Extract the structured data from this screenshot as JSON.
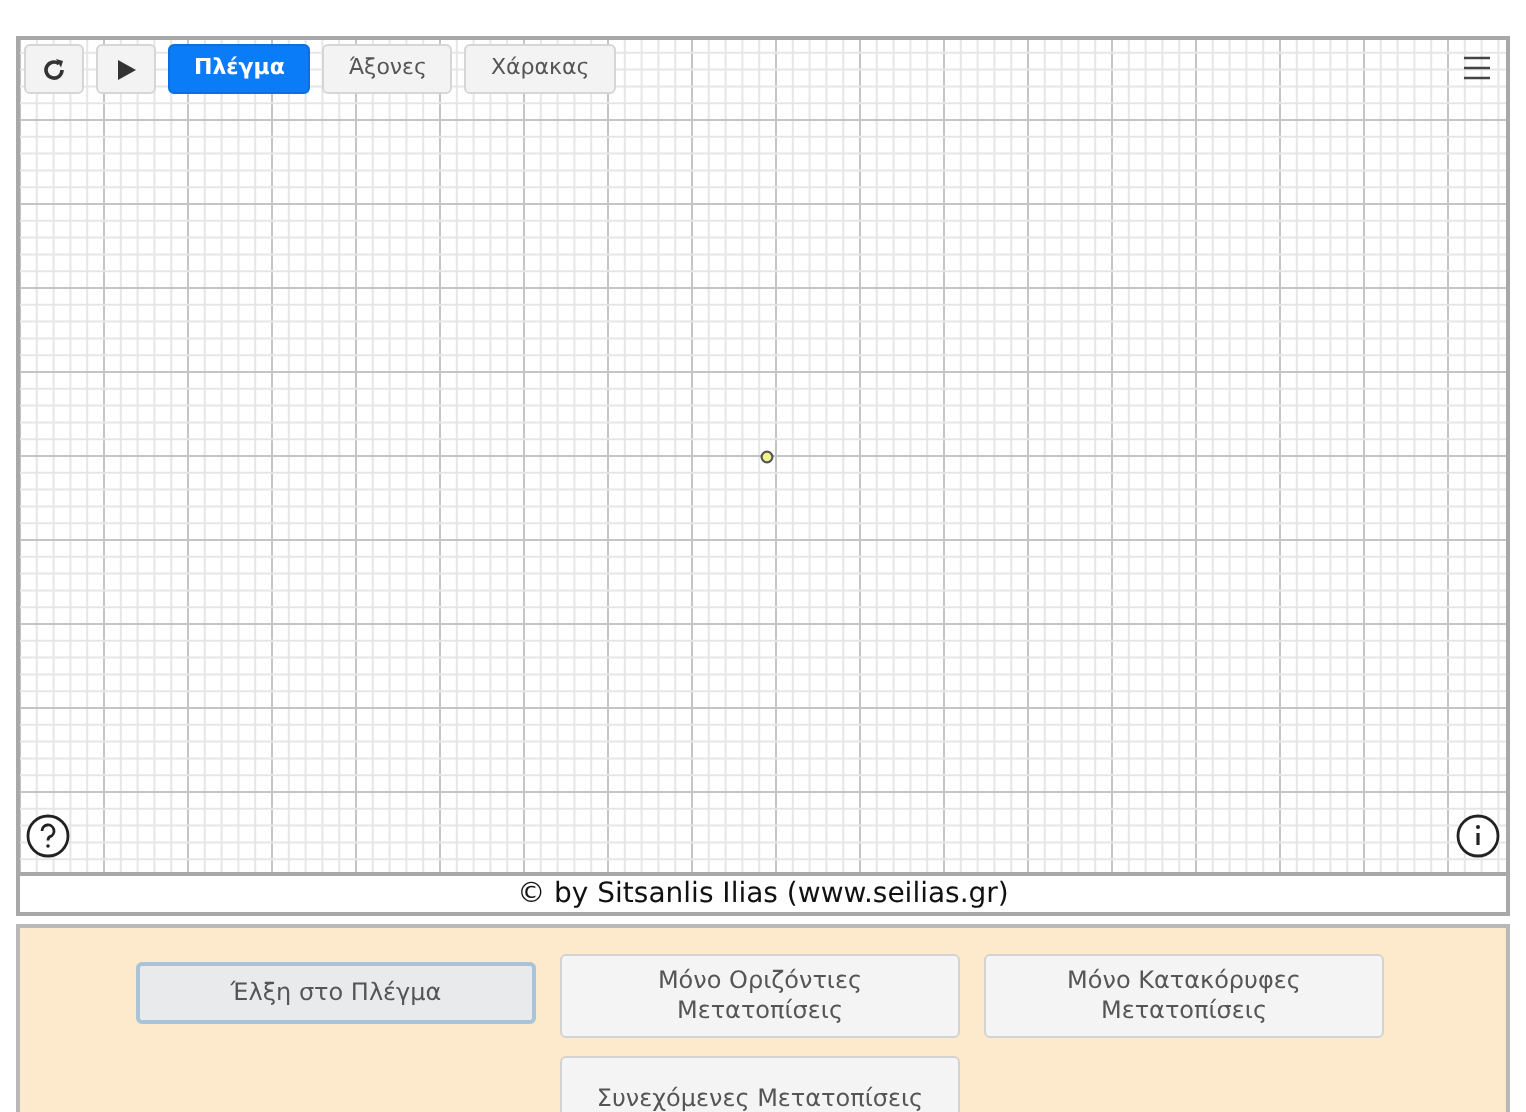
{
  "toolbar": {
    "buttons": [
      {
        "kind": "reset"
      },
      {
        "kind": "play"
      }
    ],
    "tabs": [
      {
        "label": "Πλέγμα",
        "selected": true
      },
      {
        "label": "Άξονες",
        "selected": false
      },
      {
        "label": "Χάρακας",
        "selected": false
      }
    ]
  },
  "footer": {
    "credit": "© by Sitsanlis Ilias (www.seilias.gr)"
  },
  "options": [
    {
      "label": "Έλξη στο Πλέγμα",
      "selected": true
    },
    {
      "label": "Μόνο Οριζόντιες Μετατοπίσεις",
      "selected": false
    },
    {
      "label": "Μόνο Κατακόρυφες Μετατοπίσεις",
      "selected": false
    },
    {
      "label": "Συνεχόμενες Μετατοπίσεις",
      "selected": false
    }
  ]
}
